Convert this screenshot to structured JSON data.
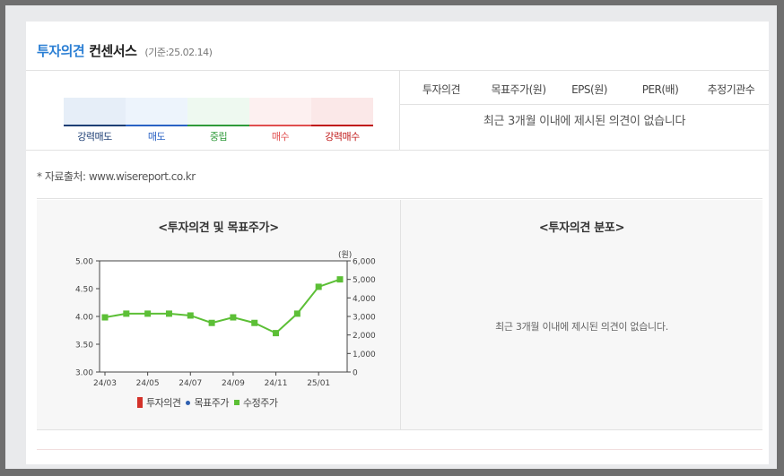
{
  "header": {
    "title_main": "투자의견",
    "title_sub": "컨센서스",
    "date": "(기준:25.02.14)"
  },
  "scale": [
    {
      "label": "강력매도",
      "color": "#1e3f75",
      "bg": "#e6eef8"
    },
    {
      "label": "매도",
      "color": "#2a62c4",
      "bg": "#edf4fc"
    },
    {
      "label": "중립",
      "color": "#2f9a3a",
      "bg": "#eef9f0"
    },
    {
      "label": "매수",
      "color": "#e04e4e",
      "bg": "#fdf0f0"
    },
    {
      "label": "강력매수",
      "color": "#c01818",
      "bg": "#fbe8e8"
    }
  ],
  "table": {
    "headers": [
      "투자의견",
      "목표주가(원)",
      "EPS(원)",
      "PER(배)",
      "추정기관수"
    ],
    "empty_message": "최근 3개월 이내에 제시된 의견이 없습니다"
  },
  "source": "* 자료출처: www.wisereport.co.kr",
  "left_section": {
    "title": "<투자의견 및 목표주가>"
  },
  "right_section": {
    "title": "<투자의견 분포>",
    "empty_message": "최근 3개월 이내에 제시된 의견이 없습니다."
  },
  "chart_data": {
    "type": "line",
    "x": [
      "24/03",
      "24/04",
      "24/05",
      "24/06",
      "24/07",
      "24/08",
      "24/09",
      "24/10",
      "24/11",
      "24/12",
      "25/01",
      "25/02"
    ],
    "x_tick_labels": [
      "24/03",
      "24/05",
      "24/07",
      "24/09",
      "24/11",
      "25/01"
    ],
    "y_left": {
      "ticks": [
        "5.00",
        "4.50",
        "4.00",
        "3.50",
        "3.00"
      ],
      "lim": [
        3.0,
        5.0
      ]
    },
    "y_right": {
      "unit": "(원)",
      "ticks": [
        "6,000",
        "5,000",
        "4,000",
        "3,000",
        "2,000",
        "1,000",
        "0"
      ],
      "lim": [
        0,
        6000
      ]
    },
    "series": [
      {
        "name": "투자의견",
        "color": "#d3322a",
        "values": []
      },
      {
        "name": "목표주가",
        "color": "#2e5fb0",
        "values": []
      },
      {
        "name": "수정주가",
        "color": "#5cbf36",
        "values": [
          2950,
          3150,
          3150,
          3150,
          3050,
          2650,
          2950,
          2650,
          2100,
          3150,
          4600,
          5000
        ]
      }
    ],
    "grid": false,
    "legend": "bottom"
  }
}
